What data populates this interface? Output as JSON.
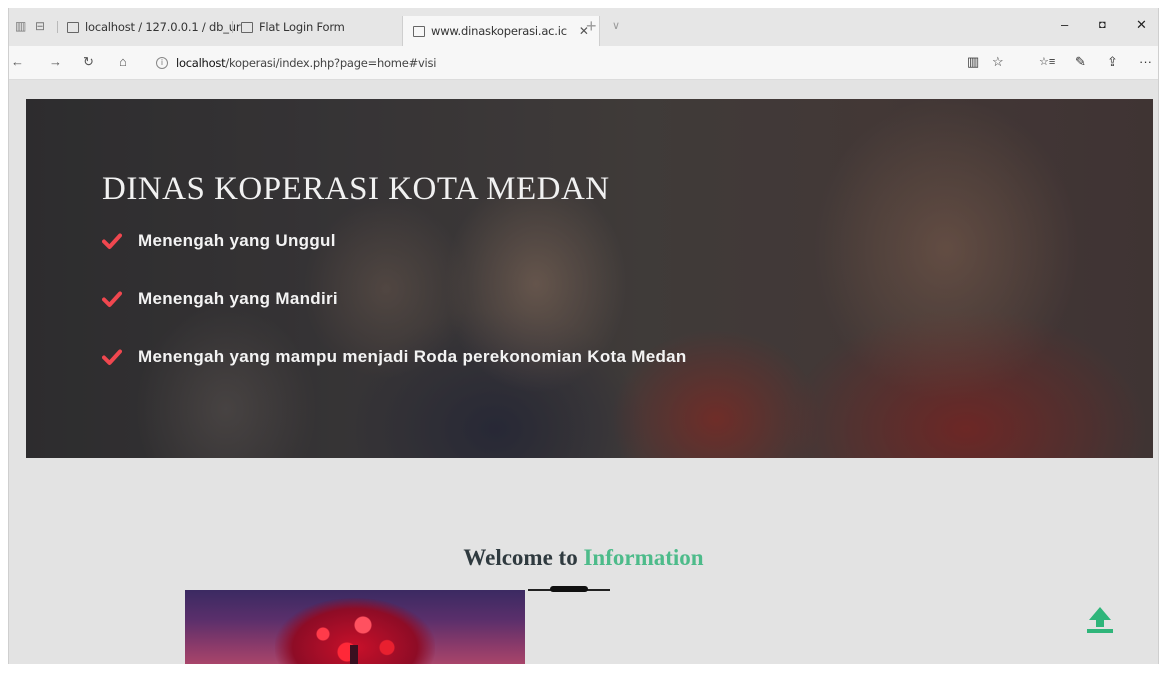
{
  "browser": {
    "tabs": [
      {
        "title": "localhost / 127.0.0.1 / db_ur",
        "active": false
      },
      {
        "title": "Flat Login Form",
        "active": false
      },
      {
        "title": "www.dinaskoperasi.ac.ic",
        "active": true
      }
    ],
    "new_tab_glyph": "+",
    "tab_menu_glyph": "∨",
    "window_buttons": {
      "minimize": "–",
      "maximize": "◘",
      "close": "✕"
    },
    "nav": {
      "back": "←",
      "forward": "→",
      "refresh": "↻",
      "home": "⌂"
    },
    "address": {
      "host": "localhost",
      "path": "/koperasi/index.php?page=home#visi"
    },
    "toolbar_icons": [
      "reading-view-icon",
      "favorite-star-icon",
      "favorites-hub-icon",
      "pen-icon",
      "share-icon",
      "more-icon"
    ],
    "toolbar_glyphs": {
      "reading": "▥",
      "star": "☆",
      "hub": "☆≡",
      "pen": "✎",
      "share": "⇪",
      "more": "···"
    }
  },
  "hero": {
    "title": "DINAS KOPERASI KOTA MEDAN",
    "visi": [
      "Menengah yang Unggul",
      "Menengah yang Mandiri",
      "Menengah yang mampu menjadi Roda perekonomian Kota Medan"
    ]
  },
  "welcome": {
    "prefix": "Welcome to",
    "accent": "Information"
  },
  "colors": {
    "accent_green": "#4dbb8a",
    "check_red": "#f0474f",
    "heading_dark": "#2f3a3f"
  }
}
